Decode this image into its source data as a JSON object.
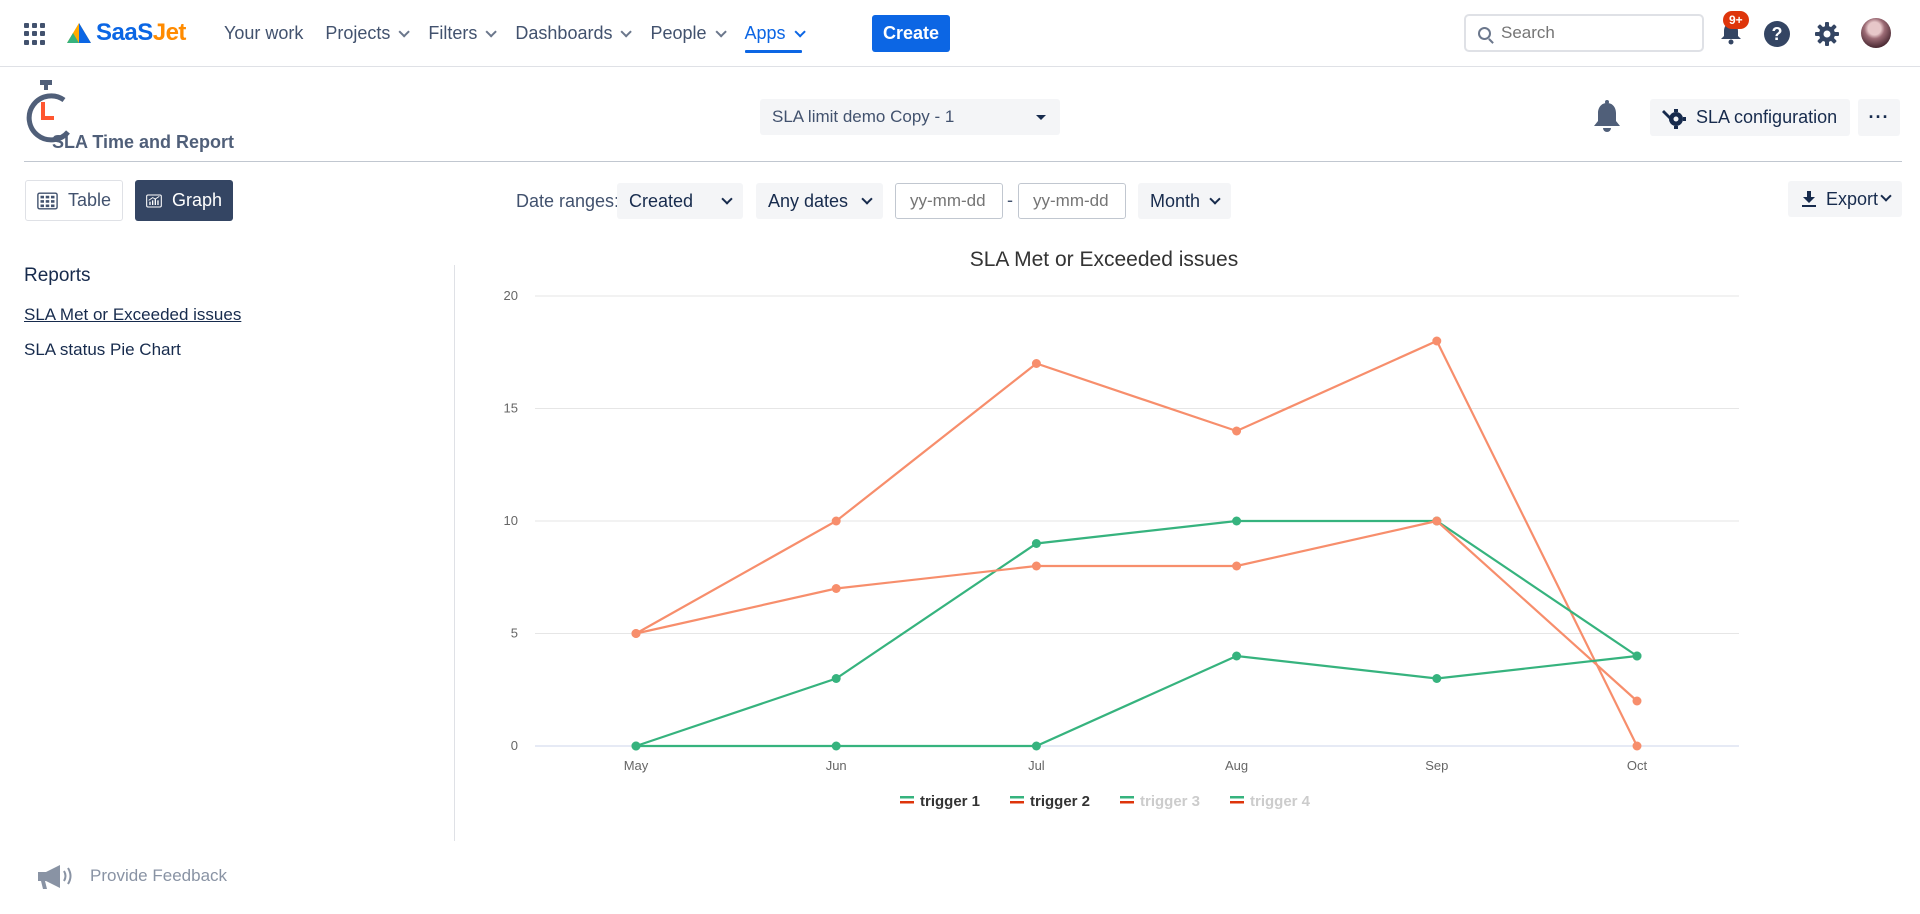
{
  "topnav": {
    "brand": {
      "part1": "SaaS",
      "part2": "Jet"
    },
    "items": [
      {
        "label": "Your work",
        "has_menu": false,
        "active": false
      },
      {
        "label": "Projects",
        "has_menu": true,
        "active": false
      },
      {
        "label": "Filters",
        "has_menu": true,
        "active": false
      },
      {
        "label": "Dashboards",
        "has_menu": true,
        "active": false
      },
      {
        "label": "People",
        "has_menu": true,
        "active": false
      },
      {
        "label": "Apps",
        "has_menu": true,
        "active": true
      }
    ],
    "create_label": "Create",
    "search_placeholder": "Search",
    "notification_badge": "9+",
    "help_glyph": "?",
    "colors": {
      "accent": "#0c66e4",
      "badge": "#de350b"
    }
  },
  "app_header": {
    "title": "SLA Time and Report",
    "sla_selected": "SLA limit demo Copy - 1",
    "config_label": "SLA configuration",
    "more_label": "···"
  },
  "toolbar": {
    "table_label": "Table",
    "graph_label": "Graph",
    "date_ranges_label": "Date ranges:",
    "created_value": "Created",
    "any_dates_value": "Any dates",
    "date_from_placeholder": "yy-mm-dd",
    "date_separator": "-",
    "date_to_placeholder": "yy-mm-dd",
    "period_value": "Month",
    "export_label": "Export"
  },
  "sidebar": {
    "title": "Reports",
    "items": [
      {
        "label": "SLA Met or Exceeded issues",
        "active": true
      },
      {
        "label": "SLA status Pie Chart",
        "active": false
      }
    ]
  },
  "feedback_label": "Provide Feedback",
  "chart_data": {
    "type": "line",
    "title": "SLA Met or Exceeded issues",
    "categories": [
      "May",
      "Jun",
      "Jul",
      "Aug",
      "Sep",
      "Oct"
    ],
    "ylim": [
      0,
      20
    ],
    "yticks": [
      0,
      5,
      10,
      15,
      20
    ],
    "grid": true,
    "legend_position": "bottom",
    "series": [
      {
        "name": "trigger 1",
        "kind": "exceeded",
        "color": "#f78e6c",
        "values": [
          5,
          10,
          17,
          14,
          18,
          0
        ]
      },
      {
        "name": "trigger 1",
        "kind": "met",
        "color": "#36b37e",
        "values": [
          0,
          3,
          9,
          10,
          10,
          4
        ]
      },
      {
        "name": "trigger 2",
        "kind": "exceeded",
        "color": "#f78e6c",
        "values": [
          5,
          7,
          8,
          8,
          10,
          2
        ]
      },
      {
        "name": "trigger 2",
        "kind": "met",
        "color": "#36b37e",
        "values": [
          0,
          0,
          0,
          4,
          3,
          4
        ]
      }
    ],
    "legend": [
      {
        "label": "trigger 1",
        "enabled": true
      },
      {
        "label": "trigger 2",
        "enabled": true
      },
      {
        "label": "trigger 3",
        "enabled": false
      },
      {
        "label": "trigger 4",
        "enabled": false
      }
    ],
    "legend_swatch_colors": {
      "top": "#36b37e",
      "bottom": "#de350b"
    }
  }
}
